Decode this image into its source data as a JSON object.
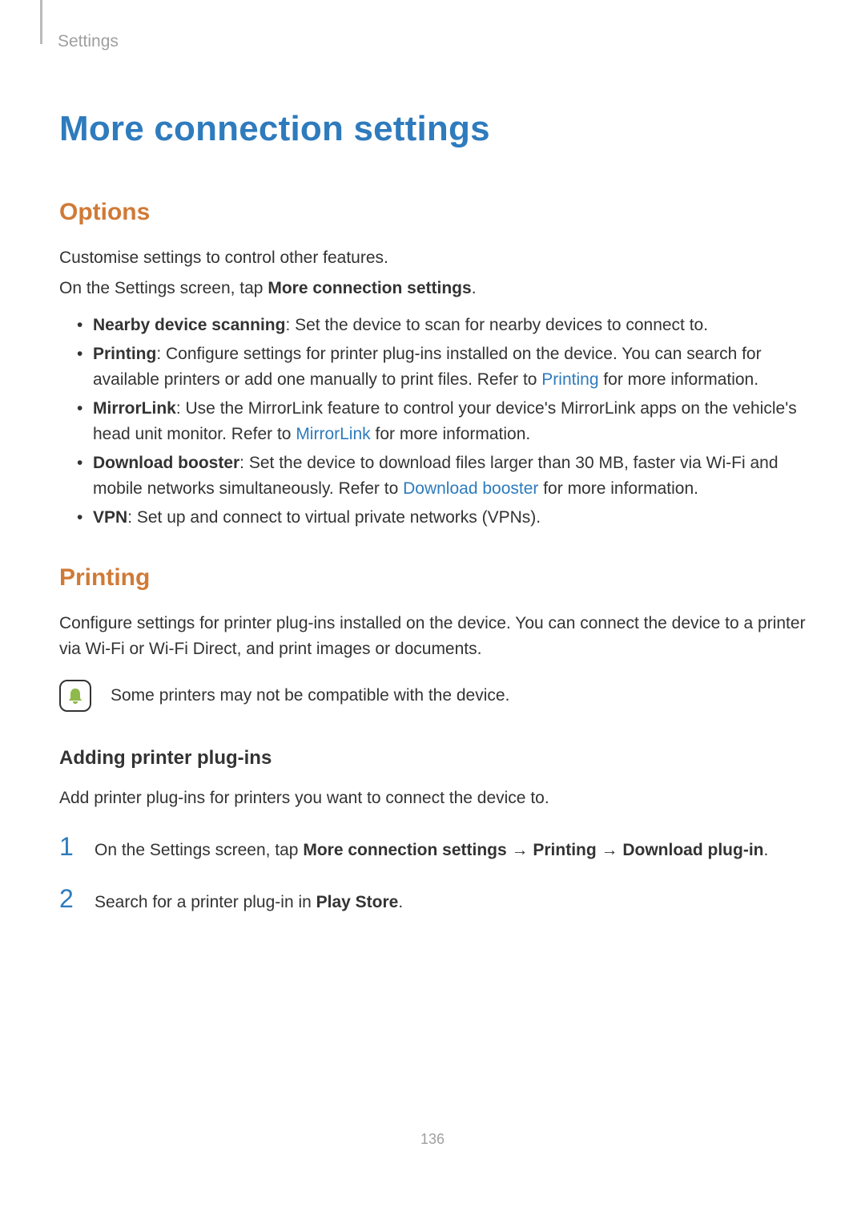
{
  "breadcrumb": "Settings",
  "title": "More connection settings",
  "sections": {
    "options": {
      "heading": "Options",
      "intro1": "Customise settings to control other features.",
      "intro2_pre": "On the Settings screen, tap ",
      "intro2_bold": "More connection settings",
      "intro2_post": ".",
      "items": [
        {
          "label": "Nearby device scanning",
          "text": ": Set the device to scan for nearby devices to connect to."
        },
        {
          "label": "Printing",
          "text_pre": ": Configure settings for printer plug-ins installed on the device. You can search for available printers or add one manually to print files. Refer to ",
          "link": "Printing",
          "text_post": " for more information."
        },
        {
          "label": "MirrorLink",
          "text_pre": ": Use the MirrorLink feature to control your device's MirrorLink apps on the vehicle's head unit monitor. Refer to ",
          "link": "MirrorLink",
          "text_post": " for more information."
        },
        {
          "label": "Download booster",
          "text_pre": ": Set the device to download files larger than 30 MB, faster via Wi-Fi and mobile networks simultaneously. Refer to ",
          "link": "Download booster",
          "text_post": " for more information."
        },
        {
          "label": "VPN",
          "text": ": Set up and connect to virtual private networks (VPNs)."
        }
      ]
    },
    "printing": {
      "heading": "Printing",
      "intro": "Configure settings for printer plug-ins installed on the device. You can connect the device to a printer via Wi-Fi or Wi-Fi Direct, and print images or documents.",
      "note": "Some printers may not be compatible with the device.",
      "sub_heading": "Adding printer plug-ins",
      "sub_intro": "Add printer plug-ins for printers you want to connect the device to.",
      "steps": [
        {
          "num": "1",
          "pre": "On the Settings screen, tap ",
          "b1": "More connection settings",
          "arrow1": " → ",
          "b2": "Printing",
          "arrow2": " → ",
          "b3": "Download plug-in",
          "post": "."
        },
        {
          "num": "2",
          "pre": "Search for a printer plug-in in ",
          "b1": "Play Store",
          "post": "."
        }
      ]
    }
  },
  "page_number": "136"
}
